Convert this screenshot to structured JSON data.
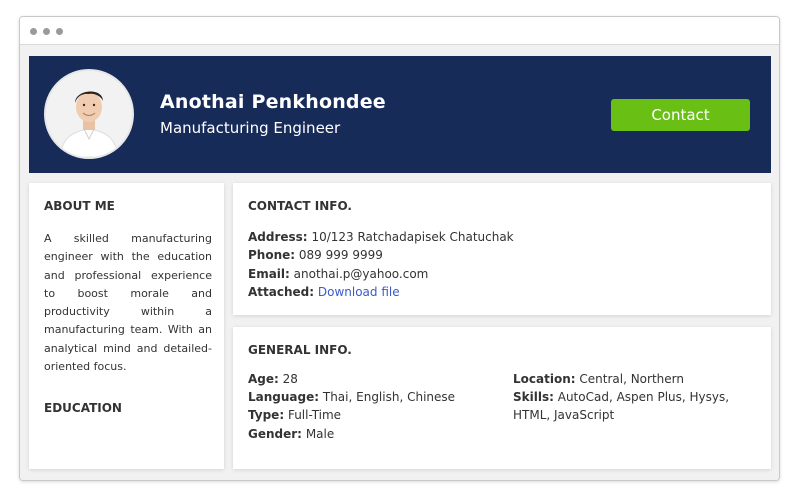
{
  "profile": {
    "name": "Anothai Penkhondee",
    "role": "Manufacturing Engineer",
    "contact_button": "Contact"
  },
  "about": {
    "title": "ABOUT ME",
    "text": "A skilled manufacturing engineer with the education and professional experience to boost morale and productivity within a manufacturing team. With an analytical mind and detailed-oriented focus.",
    "education_title": "EDUCATION"
  },
  "contact_info": {
    "title": "CONTACT INFO.",
    "address_label": "Address:",
    "address_value": "10/123 Ratchadapisek Chatuchak",
    "phone_label": "Phone:",
    "phone_value": "089 999 9999",
    "email_label": "Email:",
    "email_value": "anothai.p@yahoo.com",
    "attached_label": "Attached:",
    "attached_link": "Download file"
  },
  "general_info": {
    "title": "GENERAL INFO.",
    "age_label": "Age:",
    "age_value": "28",
    "language_label": "Language:",
    "language_value": "Thai, English, Chinese",
    "type_label": "Type:",
    "type_value": "Full-Time",
    "gender_label": "Gender:",
    "gender_value": "Male",
    "location_label": "Location:",
    "location_value": "Central, Northern",
    "skills_label": "Skills:",
    "skills_value_line1": "AutoCad, Aspen Plus, Hysys,",
    "skills_value_line2": "HTML, JavaScript"
  },
  "colors": {
    "header_bg": "#172b59",
    "accent": "#6abf14",
    "link": "#3b5bc9"
  },
  "icons": [
    "window-dot-icon"
  ]
}
